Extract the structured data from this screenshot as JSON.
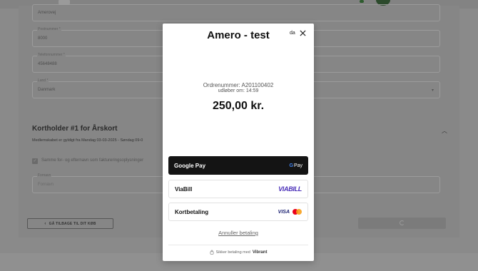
{
  "background": {
    "fields": [
      {
        "label": "",
        "value": "Amerovej"
      },
      {
        "label": "Postnummer *",
        "value": "8000"
      },
      {
        "label": "Telefonnummer *",
        "value": "45648488"
      },
      {
        "label": "Land *",
        "value": "Danmark"
      }
    ],
    "section_title": "Kortholder #1 for Årskort",
    "section_subtitle": "Medlemskabet er gyldigt fra Mandag 03-03-2025 - Søndag 09-0",
    "same_name_checkbox_label": "Samme for- og efternavn som faktureringsoplysninger",
    "name_field": {
      "label": "Fornavn",
      "placeholder": "Fornavn"
    },
    "back_button_label": "GÅ TILBAGE TIL DIT KØB"
  },
  "modal": {
    "title": "Amero - test",
    "language": "da",
    "order_number": "Ordrenummer: A201100402",
    "expires": "udløber om: 14:59",
    "amount": "250,00 kr.",
    "payment_options": {
      "google_pay": {
        "label": "Google Pay",
        "logo_text": "Pay",
        "logo_g": "G"
      },
      "viabill": {
        "label": "ViaBill",
        "logo_text": "VIABILL"
      },
      "card": {
        "label": "Kortbetaling",
        "visa_text": "VISA"
      }
    },
    "cancel_label": "Annuller betaling",
    "secure_label": "Sikker betaling med",
    "provider": "Vibrant"
  },
  "colors": {
    "overlay": "#8a8a8a",
    "google_pay_bg": "#141414",
    "viabill_purple": "#4a2fb8",
    "visa_blue": "#1a1f71",
    "mastercard_red": "#eb001b",
    "mastercard_orange": "#f79e1b"
  },
  "icons": [
    "close-icon",
    "lock-icon",
    "chevron-down-icon",
    "chevron-up-icon",
    "arrow-left-icon",
    "checkbox-checked-icon"
  ]
}
